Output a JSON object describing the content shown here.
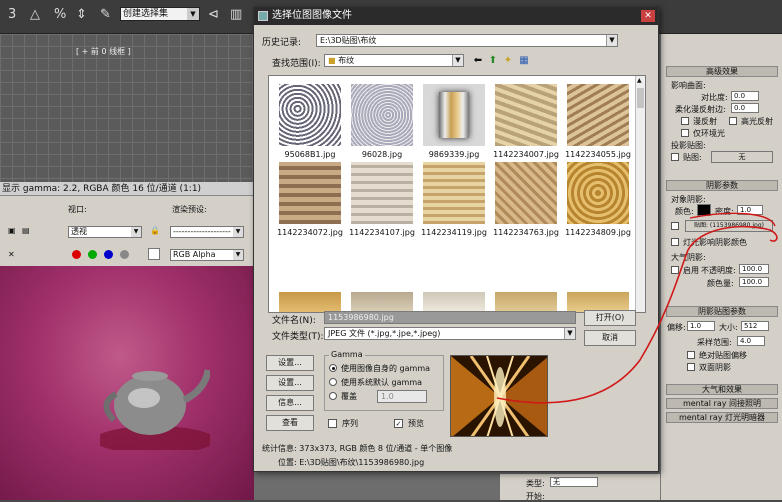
{
  "toolbar": {
    "selection_set": "创建选择集"
  },
  "viewport": {
    "label": "[ + 前 0 线框 ]"
  },
  "frame_window": {
    "title": "显示 gamma: 2.2, RGBA 颜色 16 位/通道 (1:1)",
    "viewport_label": "视口:",
    "viewport_value": "透视",
    "preset_label": "渲染预设:",
    "preset_value": "--------------------",
    "channel_value": "RGB Alpha"
  },
  "dialog": {
    "title": "选择位图图像文件",
    "history_label": "历史记录:",
    "history_value": "E:\\3D贴图\\布纹",
    "lookin_label": "查找范围(I):",
    "lookin_value": "布纹",
    "files": [
      {
        "name": "95068B1.jpg"
      },
      {
        "name": "96028.jpg"
      },
      {
        "name": "9869339.jpg"
      },
      {
        "name": "1142234007.jpg"
      },
      {
        "name": "1142234055.jpg"
      },
      {
        "name": "1142234072.jpg"
      },
      {
        "name": "1142234107.jpg"
      },
      {
        "name": "1142234119.jpg"
      },
      {
        "name": "1142234763.jpg"
      },
      {
        "name": "1142234809.jpg"
      },
      {
        "name": ""
      },
      {
        "name": ""
      },
      {
        "name": ""
      },
      {
        "name": ""
      },
      {
        "name": ""
      }
    ],
    "filename_label": "文件名(N):",
    "filename_value": "1153986980.jpg",
    "filetype_label": "文件类型(T):",
    "filetype_value": "JPEG 文件 (*.jpg,*.jpe,*.jpeg)",
    "open_button": "打开(O)",
    "cancel_button": "取消",
    "setup_button": "设置...",
    "settings_button": "设置...",
    "info_button": "信息...",
    "view_button": "查看",
    "gamma_title": "Gamma",
    "gamma_opt1": "使用图像自身的 gamma",
    "gamma_opt2": "使用系统默认 gamma",
    "gamma_opt3": "覆盖",
    "gamma_value": "1.0",
    "sequence_label": "序列",
    "preview_label": "预览",
    "stats_line": "统计信息: 373x373, RGB 颜色 8 位/通道 - 单个图像",
    "location_line": "位置: E:\\3D贴图\\布纹\\1153986980.jpg"
  },
  "right_panel": {
    "advanced_title": "高级效果",
    "affect_surface": "影响曲面:",
    "contrast_label": "对比度:",
    "contrast_value": "0.0",
    "soften_label": "柔化漫反射边:",
    "soften_value": "0.0",
    "diffuse_label": "漫反射",
    "specular_label": "高光反射",
    "ambient_label": "仅环境光",
    "projector_label": "投影贴图:",
    "map_label": "贴图:",
    "none_label": "无",
    "shadow_params_title": "阴影参数",
    "object_shadow": "对象阴影:",
    "color_label": "颜色:",
    "density_label": "密度:",
    "density_value": "1.0",
    "map_file": "贴图: (1153986980.jpg)",
    "light_affects": "灯光影响阴影颜色",
    "atmos_shadow": "大气阴影:",
    "enable_label": "启用",
    "opacity_label": "不透明度:",
    "opacity_value": "100.0",
    "color_amount_label": "颜色量:",
    "color_amount_value": "100.0",
    "shadow_map_title": "阴影贴图参数",
    "bias_label": "偏移:",
    "bias_value": "1.0",
    "size_label": "大小:",
    "size_value": "512",
    "sample_label": "采样范围:",
    "sample_value": "4.0",
    "absolute_bias": "绝对贴图偏移",
    "two_sided": "双面阴影",
    "atmos_effects": "大气和效果",
    "mr_indirect": "mental ray 间接照明",
    "mr_shader": "mental ray 灯光明暗器",
    "type_label": "类型:",
    "type_value": "无",
    "start_label": "开始:"
  }
}
